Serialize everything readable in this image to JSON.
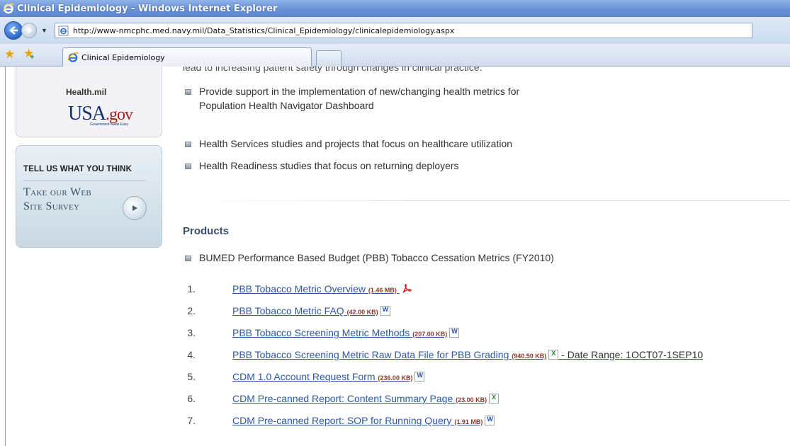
{
  "window": {
    "title": "Clinical Epidemiology - Windows Internet Explorer"
  },
  "address": {
    "url": "http://www-nmcphc.med.navy.mil/Data_Statistics/Clinical_Epidemiology/clinicalepidemiology.aspx"
  },
  "tabs": [
    {
      "label": "Clinical Epidemiology"
    }
  ],
  "sidebar": {
    "healthmil": "Health.mil",
    "usagov_main": "USA",
    "usagov_dot": ".gov",
    "usagov_sub": "Government Made Easy",
    "feedback_heading": "TELL US WHAT YOU THINK",
    "survey_line1": "Take our Web",
    "survey_line2": "Site Survey"
  },
  "main": {
    "clipped_text": "lead to increasing patient safety through changes in clinical practice.",
    "bullets": [
      {
        "line1": "Provide support in the implementation of new/changing health metrics for",
        "line2": "Population Health Navigator Dashboard"
      },
      {
        "line1": "Health Services studies and projects that focus on healthcare utilization"
      },
      {
        "line1": "Health Readiness studies that focus on returning deployers"
      }
    ],
    "products_heading": "Products",
    "products_bullet": "BUMED Performance Based Budget (PBB) Tobacco Cessation Metrics (FY2010)",
    "products": [
      {
        "num": "1.",
        "link": "PBB Tobacco Metric Overview",
        "size": "(1.46 MB)",
        "icon": "pdf-icon",
        "extra": ""
      },
      {
        "num": "2.",
        "link": "PBB Tobacco Metric FAQ",
        "size": "(42.00 KB)",
        "icon": "word-icon",
        "extra": ""
      },
      {
        "num": "3.",
        "link": "PBB Tobacco Screening Metric Methods",
        "size": "(207.00 KB)",
        "icon": "word-icon",
        "extra": ""
      },
      {
        "num": "4.",
        "link": "PBB Tobacco Screening Metric Raw Data File for PBB Grading",
        "size": "(940.50 KB)",
        "icon": "excel-icon",
        "extra": " - Date Range: 1OCT07-1SEP10"
      },
      {
        "num": "5.",
        "link": "CDM 1.0 Account Request Form",
        "size": "(236.00 KB)",
        "icon": "word-icon",
        "extra": ""
      },
      {
        "num": "6.",
        "link": "CDM Pre-canned Report: Content Summary Page",
        "size": "(23.00 KB)",
        "icon": "excel-icon",
        "extra": ""
      },
      {
        "num": "7.",
        "link": "CDM Pre-canned Report: SOP for Running Query",
        "size": "(1.91 MB)",
        "icon": "word-icon",
        "extra": ""
      }
    ]
  }
}
